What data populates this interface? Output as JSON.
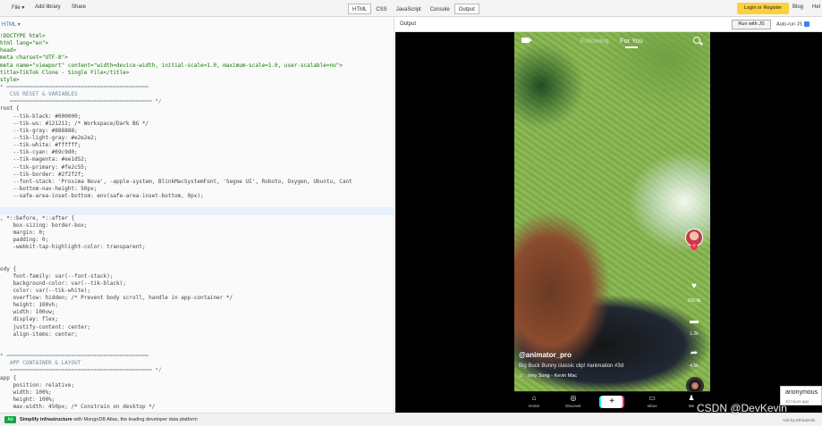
{
  "toolbar": {
    "file": "File",
    "add_library": "Add library",
    "share": "Share",
    "tabs": [
      {
        "label": "HTML",
        "active": true
      },
      {
        "label": "CSS",
        "active": false
      },
      {
        "label": "JavaScript",
        "active": false
      },
      {
        "label": "Console",
        "active": false
      },
      {
        "label": "Output",
        "active": true
      }
    ],
    "login": "Login or Register",
    "blog": "Blog",
    "help": "Hel"
  },
  "editor": {
    "language": "HTML",
    "lines": [
      {
        "text": "!DOCTYPE html>",
        "kind": "tag"
      },
      {
        "text": "html lang=\"en\">",
        "kind": "tag"
      },
      {
        "text": "head>",
        "kind": "tag"
      },
      {
        "text": "meta charset=\"UTF-8\">",
        "kind": "tag"
      },
      {
        "text": "meta name=\"viewport\" content=\"width=device-width, initial-scale=1.0, maximum-scale=1.0, user-scalable=no\">",
        "kind": "tag"
      },
      {
        "text": "title>TikTok Clone - Single File</title>",
        "kind": "tag"
      },
      {
        "text": "style>",
        "kind": "tag"
      },
      {
        "text": "* ============================================",
        "kind": "comment"
      },
      {
        "text": "   CSS RESET & VARIABLES",
        "kind": "comment"
      },
      {
        "text": "   ============================================ */",
        "kind": "comment"
      },
      {
        "text": "root {",
        "kind": "prop"
      },
      {
        "text": "    --tik-black: #000000;",
        "kind": "prop"
      },
      {
        "text": "    --tik-ws: #121212; /* Workspace/Dark BG */",
        "kind": "prop"
      },
      {
        "text": "    --tik-gray: #888888;",
        "kind": "prop"
      },
      {
        "text": "    --tik-light-gray: #e2e2e2;",
        "kind": "prop"
      },
      {
        "text": "    --tik-white: #ffffff;",
        "kind": "prop"
      },
      {
        "text": "    --tik-cyan: #69c9d0;",
        "kind": "prop"
      },
      {
        "text": "    --tik-magenta: #ee1d52;",
        "kind": "prop"
      },
      {
        "text": "    --tik-primary: #fe2c55;",
        "kind": "prop"
      },
      {
        "text": "    --tik-border: #2f2f2f;",
        "kind": "prop"
      },
      {
        "text": "    --font-stack: 'Proxima Nova', -apple-system, BlinkMacSystemFont, 'Segoe UI', Roboto, Oxygen, Ubuntu, Cant",
        "kind": "prop"
      },
      {
        "text": "    --bottom-nav-height: 50px;",
        "kind": "prop"
      },
      {
        "text": "    --safe-area-inset-bottom: env(safe-area-inset-bottom, 0px);",
        "kind": "prop"
      },
      {
        "text": "",
        "kind": "blank"
      },
      {
        "text": "",
        "kind": "highlight"
      },
      {
        "text": ", *::before, *::after {",
        "kind": "prop"
      },
      {
        "text": "    box-sizing: border-box;",
        "kind": "prop"
      },
      {
        "text": "    margin: 0;",
        "kind": "prop"
      },
      {
        "text": "    padding: 0;",
        "kind": "prop"
      },
      {
        "text": "    -webkit-tap-highlight-color: transparent;",
        "kind": "prop"
      },
      {
        "text": "",
        "kind": "blank"
      },
      {
        "text": "",
        "kind": "blank"
      },
      {
        "text": "ody {",
        "kind": "prop"
      },
      {
        "text": "    font-family: var(--font-stack);",
        "kind": "prop"
      },
      {
        "text": "    background-color: var(--tik-black);",
        "kind": "prop"
      },
      {
        "text": "    color: var(--tik-white);",
        "kind": "prop"
      },
      {
        "text": "    overflow: hidden; /* Prevent body scroll, handle in app-container */",
        "kind": "prop"
      },
      {
        "text": "    height: 100vh;",
        "kind": "prop"
      },
      {
        "text": "    width: 100vw;",
        "kind": "prop"
      },
      {
        "text": "    display: flex;",
        "kind": "prop"
      },
      {
        "text": "    justify-content: center;",
        "kind": "prop"
      },
      {
        "text": "    align-items: center;",
        "kind": "prop"
      },
      {
        "text": "",
        "kind": "blank"
      },
      {
        "text": "",
        "kind": "blank"
      },
      {
        "text": "* ============================================",
        "kind": "comment"
      },
      {
        "text": "   APP CONTAINER & LAYOUT",
        "kind": "comment"
      },
      {
        "text": "   ============================================ */",
        "kind": "comment"
      },
      {
        "text": "app {",
        "kind": "prop"
      },
      {
        "text": "    position: relative;",
        "kind": "prop"
      },
      {
        "text": "    width: 100%;",
        "kind": "prop"
      },
      {
        "text": "    height: 100%;",
        "kind": "prop"
      },
      {
        "text": "    max-width: 450px; /* Constrain on desktop */",
        "kind": "prop"
      }
    ]
  },
  "output": {
    "label": "Output",
    "run_button": "Run with JS",
    "autorun_label": "Auto-run JS",
    "autorun_checked": true
  },
  "app": {
    "feed_tabs": {
      "following": "Following",
      "for_you": "For You"
    },
    "username": "@animator_pro",
    "description": "Big Buck Bunny classic clip! #animation #3d",
    "music": "inny Song - Kevin Mac",
    "like_count": "103.0k",
    "comment_count": "1.2k",
    "share_count": "4.5k",
    "follow_symbol": "+",
    "nav": [
      {
        "label": "Home",
        "icon": "home-icon",
        "glyph": "⌂"
      },
      {
        "label": "Discover",
        "icon": "compass-icon",
        "glyph": "◎"
      },
      {
        "label": "",
        "icon": "plus-icon",
        "glyph": "+"
      },
      {
        "label": "Inbox",
        "icon": "inbox-icon",
        "glyph": "▭"
      },
      {
        "label": "Me",
        "icon": "profile-icon",
        "glyph": "♟"
      }
    ],
    "icons": {
      "like": "♥",
      "comment": "▬",
      "share": "➦",
      "music_note": "♫"
    }
  },
  "footer": {
    "ad_badge": "Ad",
    "ad_title": "Simplify infrastructure",
    "ad_rest": " with MongoDB Atlas, the leading developer data platform",
    "ads_by": "Ads by EthicalAds"
  },
  "popup": {
    "name": "anonymous",
    "time": "20 hours ago"
  },
  "watermark": "CSDN @DevKevin",
  "colors": {
    "login_yellow": "#fcd03c",
    "tiktok_pink": "#fe2c55",
    "tiktok_cyan": "#25f4ee",
    "ad_green": "#17a34a"
  }
}
